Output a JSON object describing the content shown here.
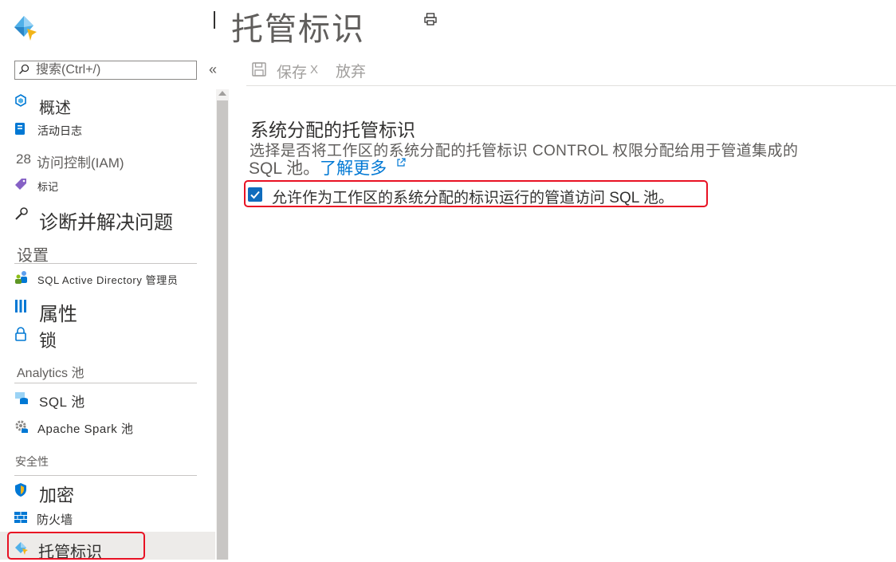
{
  "header": {
    "title": "托管标识",
    "logo_icon": "synapse-workspace-icon",
    "print_icon": "print-icon"
  },
  "sidebar": {
    "search_placeholder": "搜索(Ctrl+/)",
    "collapse_label": "«",
    "items": {
      "overview": "概述",
      "activity_log": "活动日志",
      "access_control": "访问控制(IAM)",
      "tags": "标记",
      "diagnose": "诊断并解决问题",
      "sql_ad_admin": "SQL Active Directory 管理员",
      "properties": "属性",
      "locks": "锁",
      "sql_pools": "SQL 池",
      "spark_pools": "Apache Spark 池",
      "encryption": "加密",
      "firewalls": "防火墙",
      "managed_identities": "托管标识"
    },
    "sections": {
      "settings": "设置",
      "analytics_pools": "Analytics 池",
      "security": "安全性"
    },
    "access_control_prefix": "28"
  },
  "toolbar": {
    "save": "保存",
    "save_suffix": "X",
    "discard": "放弃"
  },
  "content": {
    "section_title": "系统分配的托管标识",
    "description_line1": "选择是否将工作区的系统分配的托管标识 CONTROL 权限分配给用于管道集成的",
    "description_line2": "SQL 池。",
    "learn_more": "了解更多",
    "checkbox_label": "允许作为工作区的系统分配的标识运行的管道访问 SQL 池。",
    "checkbox_checked": true
  },
  "colors": {
    "accent": "#0078d4",
    "checkbox": "#0f6cbd",
    "highlight_border": "#e81123",
    "active_item_bg": "#edebe9"
  }
}
